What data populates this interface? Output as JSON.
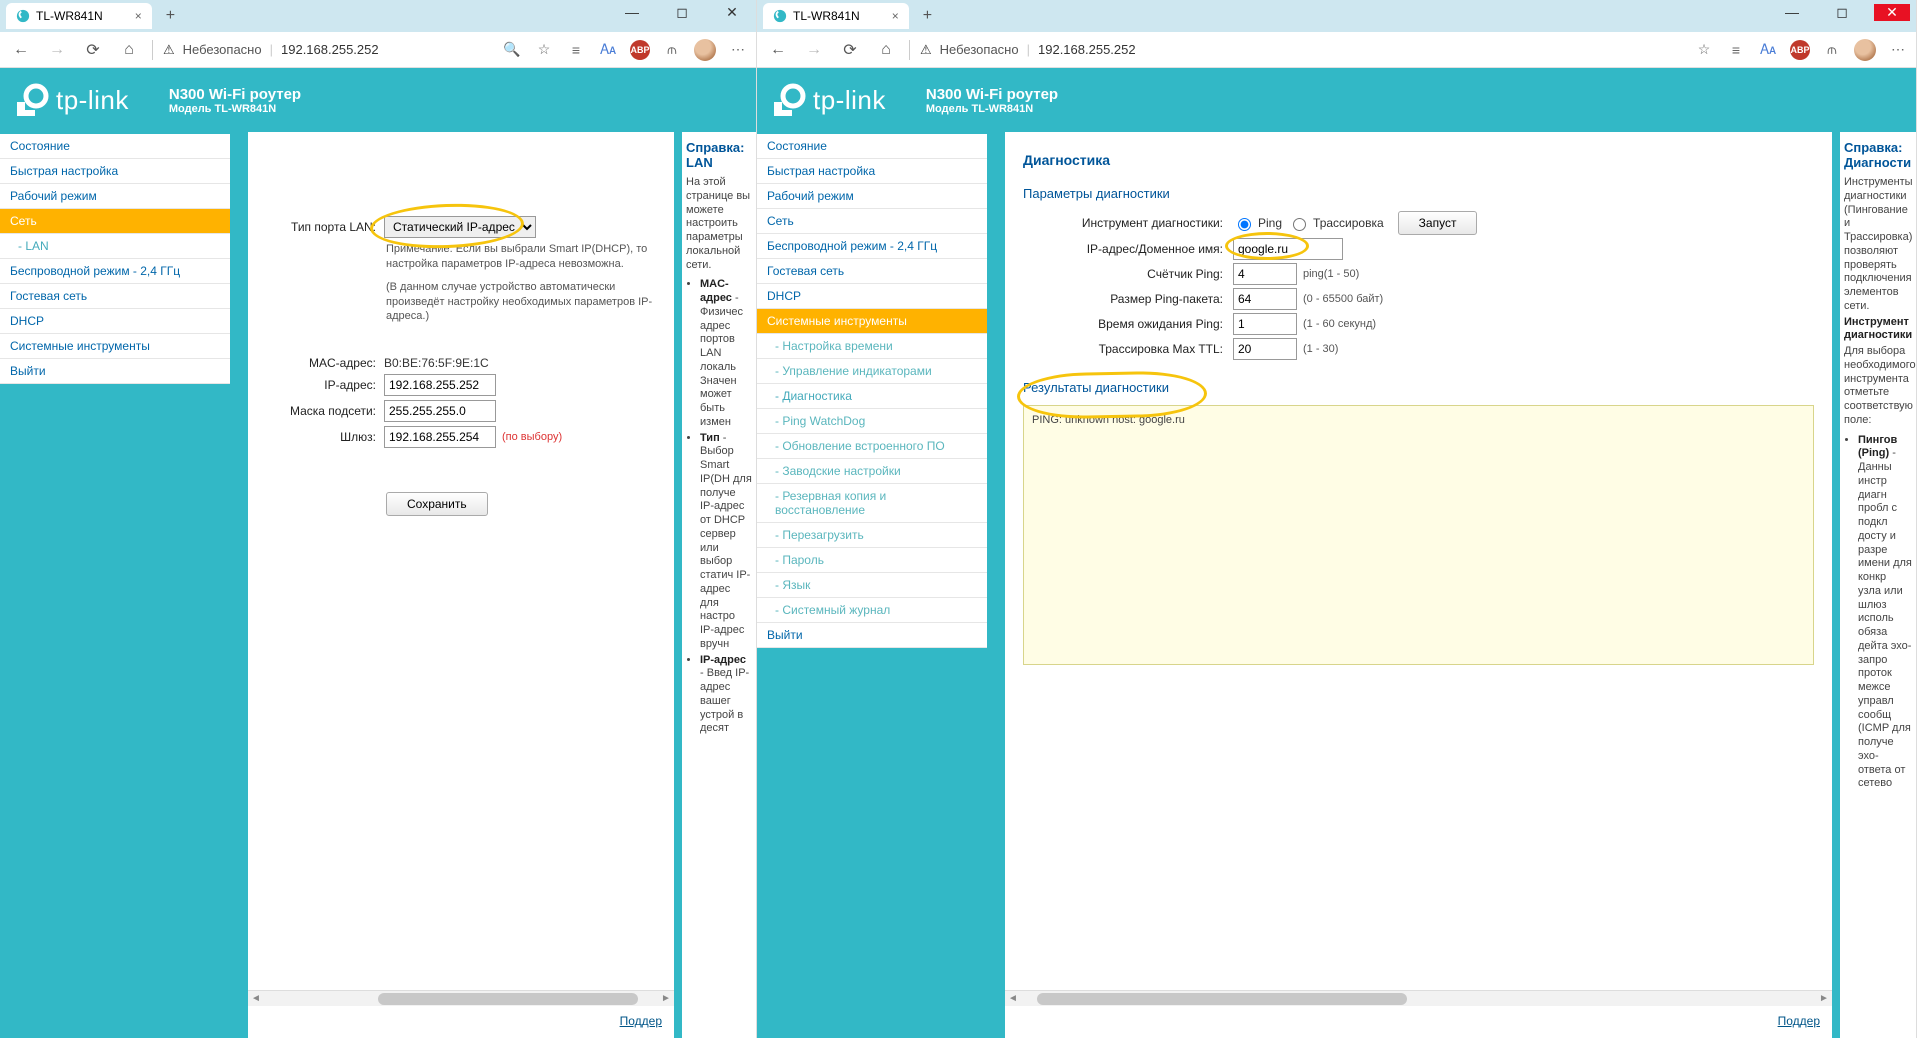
{
  "browser": {
    "tab_title": "TL-WR841N",
    "close_x": "×",
    "newtab": "+",
    "win_min": "—",
    "win_max": "◻",
    "win_close": "✕",
    "insecure_label": "Небезопасно",
    "url": "192.168.255.252",
    "abp": "ABP",
    "warn": "⚠",
    "star": "☆",
    "search": "🔍",
    "menu": "⋯"
  },
  "router": {
    "logo_text": "tp-link",
    "product_title": "N300 Wi-Fi роутер",
    "product_model": "Модель TL-WR841N",
    "support_link": "Поддер"
  },
  "sidebar_left": [
    "Состояние",
    "Быстрая настройка",
    "Рабочий режим",
    "Сеть",
    "- LAN",
    "Беспроводной режим - 2,4 ГГц",
    "Гостевая сеть",
    "DHCP",
    "Системные инструменты",
    "Выйти"
  ],
  "sidebar_right": [
    "Состояние",
    "Быстрая настройка",
    "Рабочий режим",
    "Сеть",
    "Беспроводной режим - 2,4 ГГц",
    "Гостевая сеть",
    "DHCP",
    "Системные инструменты",
    "- Настройка времени",
    "- Управление индикаторами",
    "- Диагностика",
    "- Ping WatchDog",
    "- Обновление встроенного ПО",
    "- Заводские настройки",
    "- Резервная копия и восстановление",
    "- Перезагрузить",
    "- Пароль",
    "- Язык",
    "- Системный журнал",
    "Выйти"
  ],
  "lan": {
    "port_type_label": "Тип порта LAN:",
    "port_type_value": "Статический IP-адрес",
    "note1": "Примечание. Если вы выбрали Smart IP(DHCP), то настройка параметров IP-адреса невозможна.",
    "note2": "(В данном случае устройство автоматически произведёт настройку необходимых параметров IP-адреса.)",
    "mac_label": "MAC-адрес:",
    "mac_value": "B0:BE:76:5F:9E:1C",
    "ip_label": "IP-адрес:",
    "ip_value": "192.168.255.252",
    "mask_label": "Маска подсети:",
    "mask_value": "255.255.255.0",
    "gw_label": "Шлюз:",
    "gw_value": "192.168.255.254",
    "gw_optional": "(по выбору)",
    "save_btn": "Сохранить"
  },
  "help1": {
    "title": "Справка: LAN",
    "intro": "На этой странице вы можете настроить параметры локальной сети.",
    "b1": "MAC-адрес",
    "b1t": "Физичес адрес портов LAN локаль Значен может быть измен",
    "b2": "Тип",
    "b2t": "Выбор Smart IP(DH для получе IP-адрес от DHCP сервер или выбор статич IP-адрес для настро IP-адрес вручн",
    "b3": "IP-адрес",
    "b3t": "Введ IP-адрес вашег устрой в десят"
  },
  "diag": {
    "page_title": "Диагностика",
    "params_title": "Параметры диагностики",
    "tool_label": "Инструмент диагностики:",
    "ping_label": "Ping",
    "trace_label": "Трассировка",
    "run_btn": "Запуст",
    "host_label": "IP-адрес/Доменное имя:",
    "host_value": "google.ru",
    "count_label": "Счётчик Ping:",
    "count_value": "4",
    "count_hint": "ping(1 - 50)",
    "size_label": "Размер Ping-пакета:",
    "size_value": "64",
    "size_hint": "(0 - 65500 байт)",
    "timeout_label": "Время ожидания Ping:",
    "timeout_value": "1",
    "timeout_hint": "(1 - 60 секунд)",
    "ttl_label": "Трассировка Max TTL:",
    "ttl_value": "20",
    "ttl_hint": "(1 - 30)",
    "results_title": "Результаты диагностики",
    "results_text": "PING: unknown host: google.ru"
  },
  "help2": {
    "title": "Справка: Диагности",
    "p1": "Инструменты диагностики (Пингование и Трассировка) позволяют проверять подключения элементов сети.",
    "h2": "Инструмент диагностики",
    "p2": "Для выбора необходимого инструмента отметьте соответствую поле:",
    "li1": "Пингов (Ping)",
    "li1t": "Данны инстр диагн пробл с подкл досту и разре имени для конкр узла или шлюз исполь обяза дейта эхо-запро проток межсе управл сообщ (ICMP для получе эхо-ответа от сетево"
  }
}
